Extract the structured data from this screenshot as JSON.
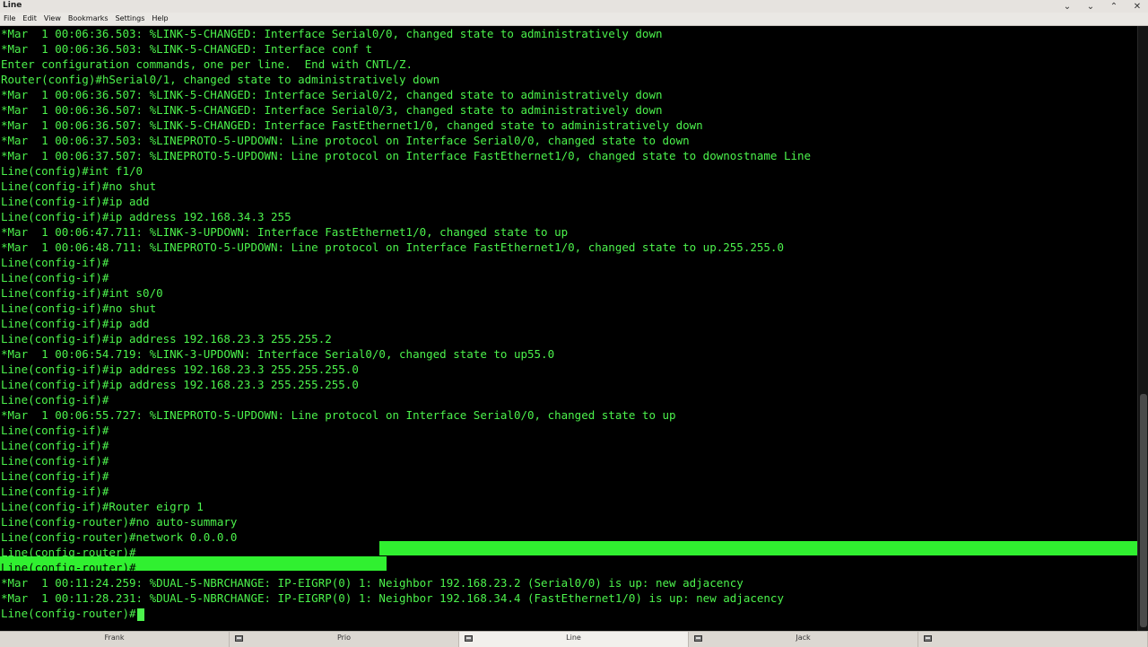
{
  "window": {
    "title": "Line"
  },
  "menu": [
    "File",
    "Edit",
    "View",
    "Bookmarks",
    "Settings",
    "Help"
  ],
  "terminal": {
    "lines": [
      "*Mar  1 00:06:36.503: %LINK-5-CHANGED: Interface Serial0/0, changed state to administratively down",
      "*Mar  1 00:06:36.503: %LINK-5-CHANGED: Interface conf t",
      "Enter configuration commands, one per line.  End with CNTL/Z.",
      "Router(config)#hSerial0/1, changed state to administratively down",
      "*Mar  1 00:06:36.507: %LINK-5-CHANGED: Interface Serial0/2, changed state to administratively down",
      "*Mar  1 00:06:36.507: %LINK-5-CHANGED: Interface Serial0/3, changed state to administratively down",
      "*Mar  1 00:06:36.507: %LINK-5-CHANGED: Interface FastEthernet1/0, changed state to administratively down",
      "*Mar  1 00:06:37.503: %LINEPROTO-5-UPDOWN: Line protocol on Interface Serial0/0, changed state to down",
      "*Mar  1 00:06:37.507: %LINEPROTO-5-UPDOWN: Line protocol on Interface FastEthernet1/0, changed state to downostname Line",
      "Line(config)#int f1/0",
      "Line(config-if)#no shut",
      "Line(config-if)#ip add",
      "Line(config-if)#ip address 192.168.34.3 255",
      "*Mar  1 00:06:47.711: %LINK-3-UPDOWN: Interface FastEthernet1/0, changed state to up",
      "*Mar  1 00:06:48.711: %LINEPROTO-5-UPDOWN: Line protocol on Interface FastEthernet1/0, changed state to up.255.255.0",
      "Line(config-if)#",
      "Line(config-if)#",
      "Line(config-if)#int s0/0",
      "Line(config-if)#no shut",
      "Line(config-if)#ip add",
      "Line(config-if)#ip address 192.168.23.3 255.255.2",
      "*Mar  1 00:06:54.719: %LINK-3-UPDOWN: Interface Serial0/0, changed state to up55.0",
      "Line(config-if)#ip address 192.168.23.3 255.255.255.0",
      "Line(config-if)#ip address 192.168.23.3 255.255.255.0",
      "Line(config-if)#",
      "*Mar  1 00:06:55.727: %LINEPROTO-5-UPDOWN: Line protocol on Interface Serial0/0, changed state to up",
      "Line(config-if)#",
      "Line(config-if)#",
      "Line(config-if)#",
      "Line(config-if)#",
      "Line(config-if)#",
      "Line(config-if)#Router eigrp 1",
      "Line(config-router)#no auto-summary",
      "Line(config-router)#network 0.0.0.0",
      "Line(config-router)#",
      "Line(config-router)#",
      "*Mar  1 00:11:24.259: %DUAL-5-NBRCHANGE: IP-EIGRP(0) 1: Neighbor 192.168.23.2 (Serial0/0) is up: new adjacency",
      "*Mar  1 00:11:28.231: %DUAL-5-NBRCHANGE: IP-EIGRP(0) 1: Neighbor 192.168.34.4 (FastEthernet1/0) is up: new adjacency",
      "Line(config-router)#"
    ],
    "text_color": "#4cf24c",
    "selection_color": "#30f030",
    "background": "#000000"
  },
  "taskbar": {
    "tabs": [
      {
        "label": "Frank"
      },
      {
        "label": "Prio"
      },
      {
        "label": "Line"
      },
      {
        "label": "Jack"
      }
    ]
  }
}
